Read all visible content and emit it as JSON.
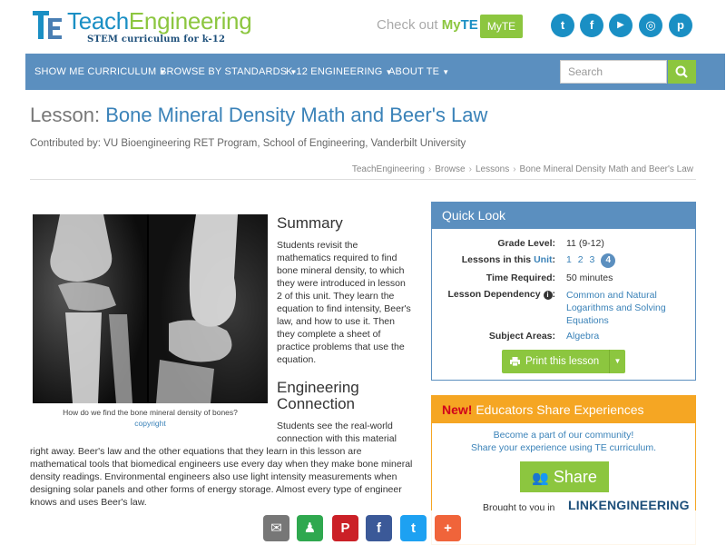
{
  "brand": {
    "name_part1": "Teach",
    "name_part2": "Engineering",
    "tagline": "STEM curriculum for k-12",
    "promo_text": "Check out ",
    "promo_my": "My",
    "promo_te": "TE",
    "myte_button": "MyTE",
    "colors": {
      "blue": "#1a8fc4",
      "green": "#8cc63f",
      "nav": "#5b8fbf",
      "orange": "#f5a623"
    }
  },
  "social": [
    {
      "name": "twitter-icon",
      "glyph": "t"
    },
    {
      "name": "facebook-icon",
      "glyph": "f"
    },
    {
      "name": "youtube-icon",
      "glyph": "▶"
    },
    {
      "name": "instagram-icon",
      "glyph": "◎"
    },
    {
      "name": "pinterest-icon",
      "glyph": "p"
    }
  ],
  "nav": {
    "items": [
      "SHOW ME CURRICULUM",
      "BROWSE BY STANDARDS",
      "K-12 ENGINEERING",
      "ABOUT TE"
    ],
    "search_placeholder": "Search"
  },
  "lesson": {
    "prefix": "Lesson:",
    "title": "Bone Mineral Density Math and Beer's Law",
    "contributed": "Contributed by: VU Bioengineering RET Program, School of Engineering, Vanderbilt University"
  },
  "breadcrumb": [
    "TeachEngineering",
    "Browse",
    "Lessons",
    "Bone Mineral Density Math and Beer's Law"
  ],
  "image": {
    "caption": "How do we find the bone mineral density of bones?",
    "copyright": "copyright"
  },
  "summary": {
    "heading": "Summary",
    "text": "Students revisit the mathematics required to find bone mineral density, to which they were introduced in lesson 2 of this unit. They learn the equation to find intensity, Beer's law, and how to use it. Then they complete a sheet of practice problems that use the equation."
  },
  "engineering": {
    "heading": "Engineering Connection",
    "text_a": "Students see the real-world connection with this material",
    "text_b": "right away. Beer's law and the other equations that they learn in this lesson are mathematical tools that biomedical engineers use every day when they make bone mineral density readings. Environmental engineers also use light intensity measurements when designing solar panels and other forms of energy storage. Almost every type of engineer knows and uses Beer's law."
  },
  "quick_look": {
    "heading": "Quick Look",
    "grade_label": "Grade Level:",
    "grade_value": "11 (9-12)",
    "lessons_label": "Lessons in this ",
    "lessons_unit": "Unit",
    "lessons_colon": ":",
    "lessons": [
      "1",
      "2",
      "3"
    ],
    "current_lesson": "4",
    "time_label": "Time Required:",
    "time_value": "50 minutes",
    "dependency_label": "Lesson Dependency",
    "dependency_value": "Common and Natural Logarithms and Solving Equations",
    "subject_label": "Subject Areas:",
    "subject_value": "Algebra",
    "print_button": "Print this lesson"
  },
  "educators": {
    "new": "New!",
    "heading": " Educators Share Experiences",
    "line1": "Become a part of our community!",
    "line2": "Share your experience using TE curriculum.",
    "share_button": "Share",
    "brought_by": "Brought to you in",
    "partner": "LINKENGINEERING"
  },
  "sharebar": [
    {
      "name": "email-share-icon",
      "glyph": "✉",
      "color": "#777777"
    },
    {
      "name": "classroom-share-icon",
      "glyph": "♟",
      "color": "#2fa84f"
    },
    {
      "name": "pinterest-share-icon",
      "glyph": "P",
      "color": "#cb2027"
    },
    {
      "name": "facebook-share-icon",
      "glyph": "f",
      "color": "#3b5998"
    },
    {
      "name": "twitter-share-icon",
      "glyph": "t",
      "color": "#1da1f2"
    },
    {
      "name": "more-share-icon",
      "glyph": "+",
      "color": "#f0643a"
    }
  ]
}
